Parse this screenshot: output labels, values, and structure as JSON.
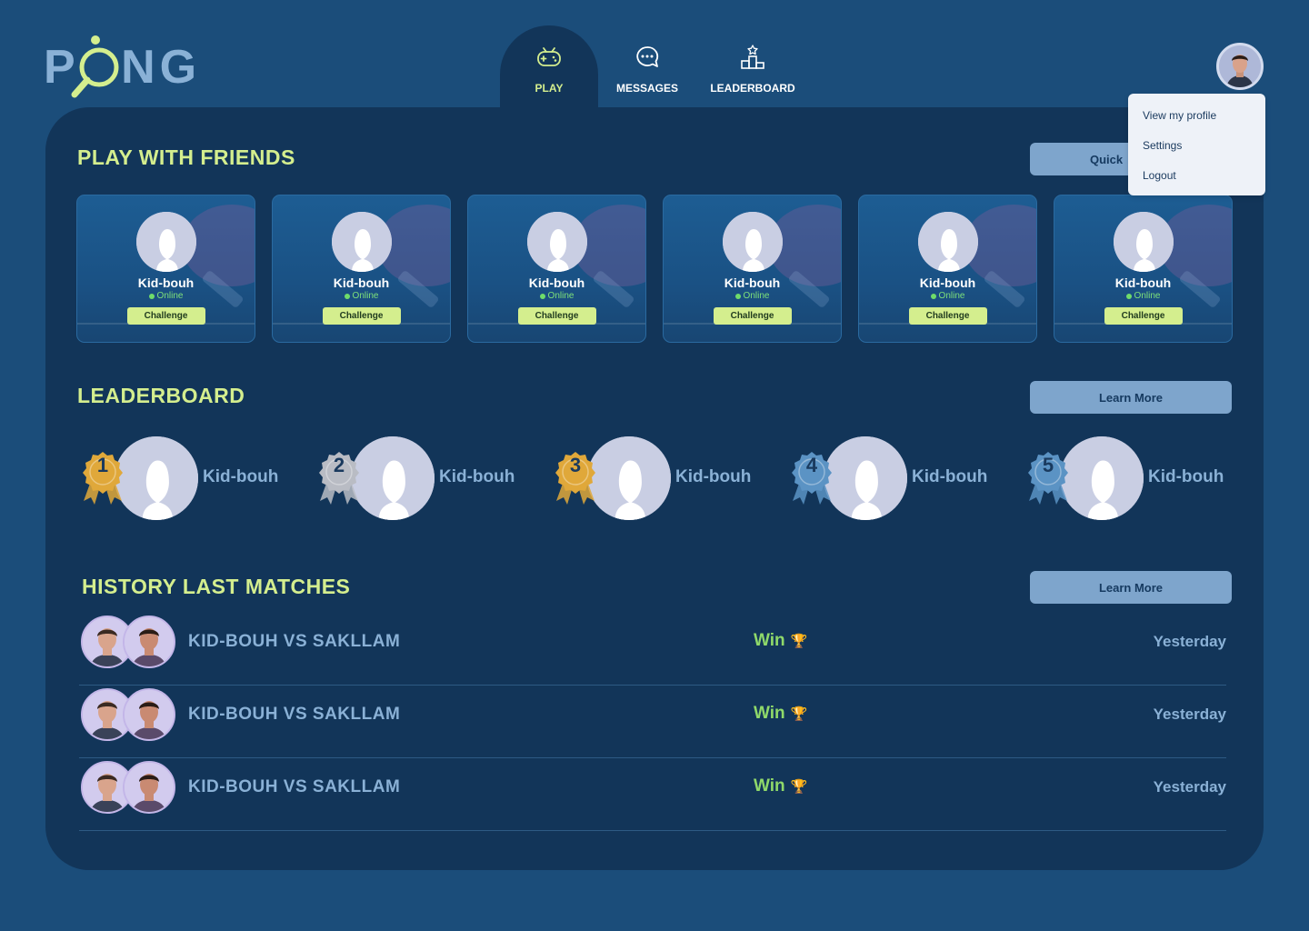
{
  "app": {
    "logo_text": "PONG"
  },
  "nav": {
    "tabs": [
      {
        "label": "PLAY",
        "icon": "gamepad-icon",
        "active": true
      },
      {
        "label": "MESSAGES",
        "icon": "chat-icon",
        "active": false
      },
      {
        "label": "LEADERBOARD",
        "icon": "podium-icon",
        "active": false
      }
    ]
  },
  "profile_menu": {
    "items": [
      "View my profile",
      "Settings",
      "Logout"
    ]
  },
  "play_with_friends": {
    "title": "PLAY WITH FRIENDS",
    "quick_button": "Quick",
    "friends": [
      {
        "name": "Kid-bouh",
        "status": "Online",
        "action": "Challenge"
      },
      {
        "name": "Kid-bouh",
        "status": "Online",
        "action": "Challenge"
      },
      {
        "name": "Kid-bouh",
        "status": "Online",
        "action": "Challenge"
      },
      {
        "name": "Kid-bouh",
        "status": "Online",
        "action": "Challenge"
      },
      {
        "name": "Kid-bouh",
        "status": "Online",
        "action": "Challenge"
      },
      {
        "name": "Kid-bouh",
        "status": "Online",
        "action": "Challenge"
      }
    ]
  },
  "leaderboard": {
    "title": "LEADERBOARD",
    "learn_more": "Learn More",
    "leaders": [
      {
        "rank": "1",
        "name": "Kid-bouh",
        "medal_color": "#e0a83a"
      },
      {
        "rank": "2",
        "name": "Kid-bouh",
        "medal_color": "#b9bcc4"
      },
      {
        "rank": "3",
        "name": "Kid-bouh",
        "medal_color": "#e0a83a"
      },
      {
        "rank": "4",
        "name": "Kid-bouh",
        "medal_color": "#5b93c4"
      },
      {
        "rank": "5",
        "name": "Kid-bouh",
        "medal_color": "#5b93c4"
      }
    ]
  },
  "history": {
    "title": "HISTORY LAST MATCHES",
    "learn_more": "Learn More",
    "matches": [
      {
        "title": "KID-BOUH VS SAKLLAM",
        "result": "Win",
        "result_icon": "🏆",
        "when": "Yesterday"
      },
      {
        "title": "KID-BOUH VS SAKLLAM",
        "result": "Win",
        "result_icon": "🏆",
        "when": "Yesterday"
      },
      {
        "title": "KID-BOUH VS SAKLLAM",
        "result": "Win",
        "result_icon": "🏆",
        "when": "Yesterday"
      }
    ]
  },
  "colors": {
    "background": "#1b4d7a",
    "panel": "#123559",
    "accent": "#d4ee8e",
    "muted_text": "#8ab1d6",
    "win": "#8fd96a",
    "online": "#6fdc6a"
  }
}
